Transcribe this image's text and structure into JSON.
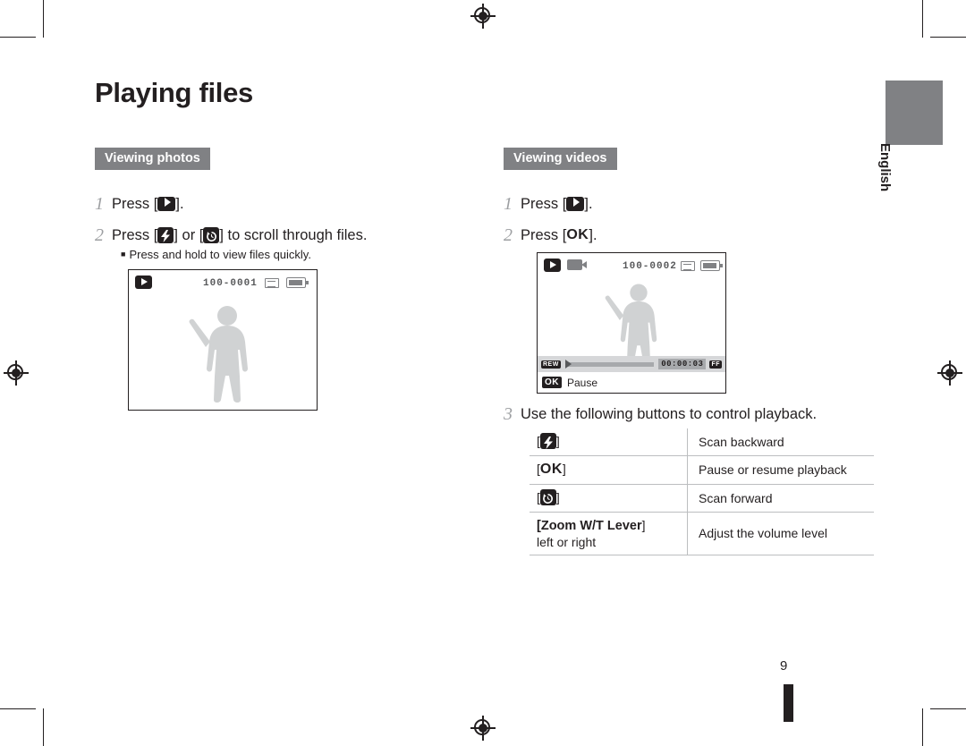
{
  "page": {
    "title": "Playing files",
    "number": "9",
    "language_tab": "English"
  },
  "left_column": {
    "section_label": "Viewing photos",
    "steps": [
      {
        "num": "1",
        "text_before": "Press [",
        "key": "play-icon",
        "text_after": "]."
      },
      {
        "num": "2",
        "text_before": "Press [",
        "key1": "flash-icon",
        "mid": "] or [",
        "key2": "timer-icon",
        "text_after": "] to scroll through files."
      }
    ],
    "note": "Press and hold to view files quickly.",
    "screen": {
      "icon": "play-icon",
      "filename": "100-0001",
      "card_icon": "memory-card-icon",
      "battery_icon": "battery-full-icon"
    }
  },
  "right_column": {
    "section_label": "Viewing videos",
    "steps": [
      {
        "num": "1",
        "text_before": "Press [",
        "key": "play-icon",
        "text_after": "]."
      },
      {
        "num": "2",
        "text_before": "Press [",
        "key": "OK",
        "text_after": "]."
      },
      {
        "num": "3",
        "text": "Use the following buttons to control playback."
      }
    ],
    "screen": {
      "icon": "play-icon",
      "movie_icon": "movie-mode-icon",
      "filename": "100-0002",
      "card_icon": "memory-card-icon",
      "battery_icon": "battery-full-icon",
      "rew_label": "REW",
      "ff_label": "FF",
      "time": "00:00:03",
      "ok_label": "OK",
      "status_label": "Pause"
    },
    "button_table": {
      "rows": [
        {
          "key_prefix": "[",
          "key_icon": "flash-icon",
          "key_suffix": "]",
          "description": "Scan backward"
        },
        {
          "key_prefix": "[",
          "key_text": "OK",
          "key_suffix": "]",
          "description": "Pause or resume playback"
        },
        {
          "key_prefix": "[",
          "key_icon": "timer-icon",
          "key_suffix": "]",
          "description": "Scan forward"
        },
        {
          "key_prefix": "[",
          "key_text": "Zoom W/T Lever",
          "key_suffix": "]",
          "key_sub": "left or right",
          "description": "Adjust the volume level"
        }
      ]
    }
  },
  "colors": {
    "heading_bg": "#808184",
    "text": "#231f20",
    "step_number": "#9d9fa2",
    "rule": "#bcbec0"
  }
}
